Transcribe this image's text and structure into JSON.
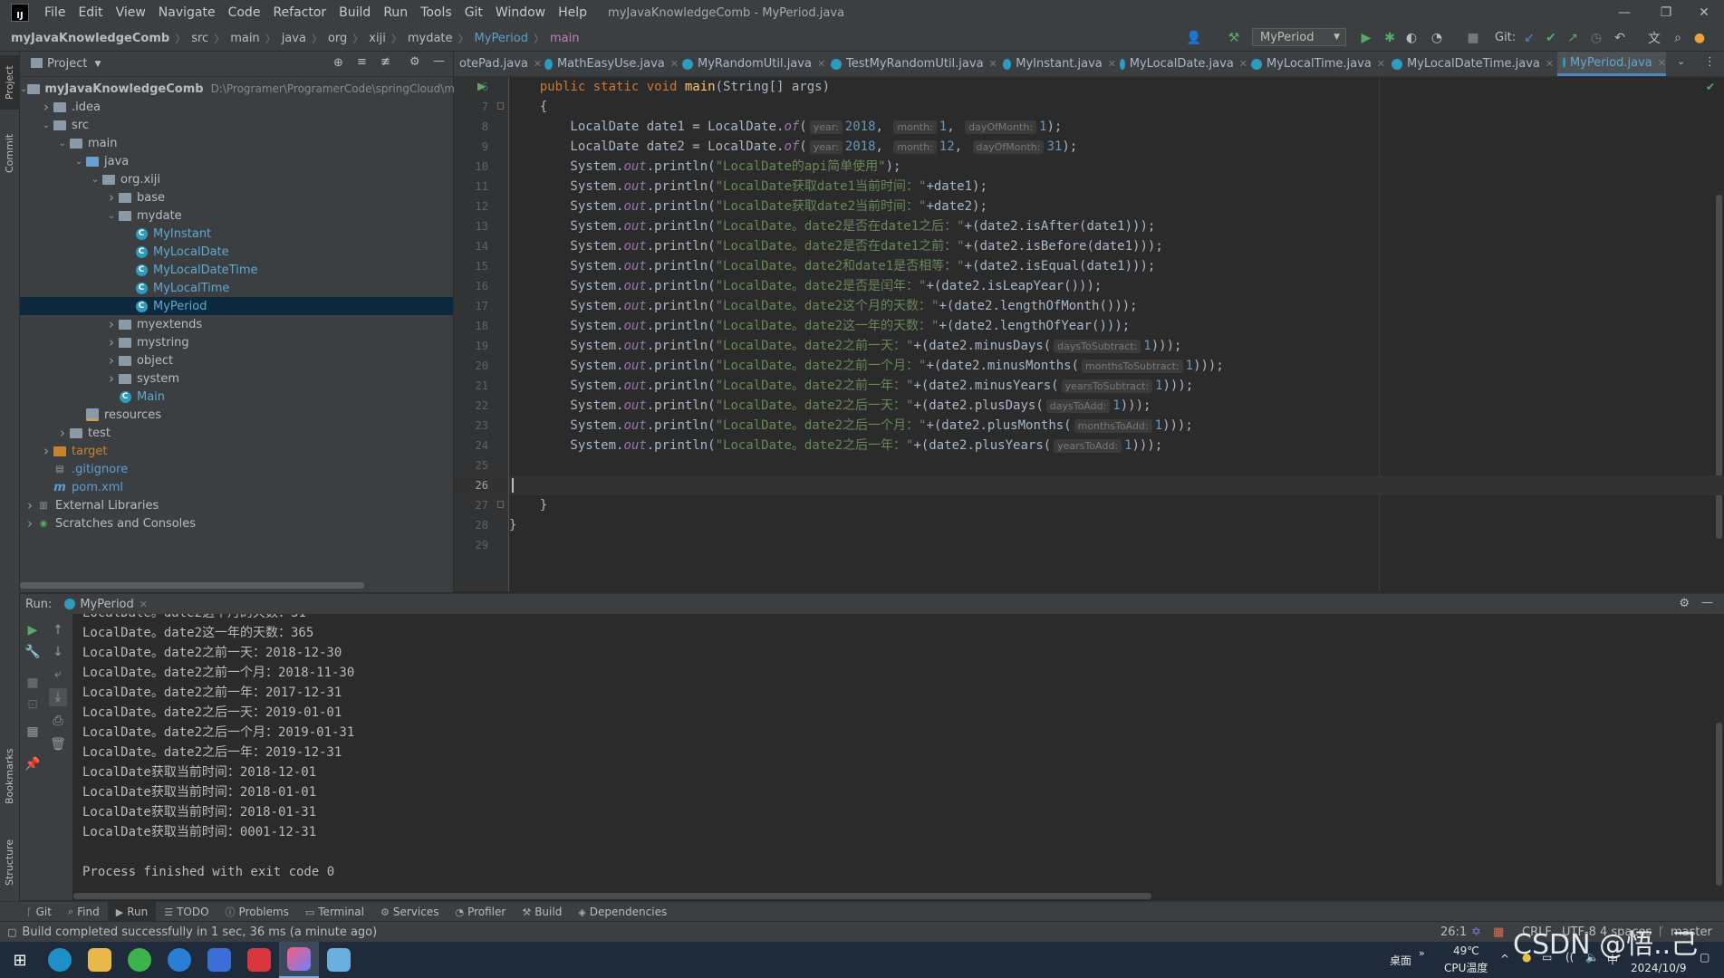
{
  "menubar": {
    "menus": [
      "File",
      "Edit",
      "View",
      "Navigate",
      "Code",
      "Refactor",
      "Build",
      "Run",
      "Tools",
      "Git",
      "Window",
      "Help"
    ],
    "window_title": "myJavaKnowledgeComb - MyPeriod.java",
    "logo": "IJ"
  },
  "navbar": {
    "crumbs": [
      "myJavaKnowledgeComb",
      "src",
      "main",
      "java",
      "org",
      "xiji",
      "mydate",
      "MyPeriod",
      "main"
    ],
    "run_config": "MyPeriod",
    "git_label": "Git:"
  },
  "left_strip": {
    "project": "Project",
    "commit": "Commit",
    "bookmarks": "Bookmarks",
    "structure": "Structure"
  },
  "project": {
    "title": "Project",
    "tree": [
      {
        "label": "myJavaKnowledgeComb",
        "extra": "D:\\Programer\\ProgramerCode\\springCloud\\my...",
        "indent": 0,
        "arrow": "down",
        "icon": "folder"
      },
      {
        "label": ".idea",
        "indent": 1,
        "arrow": "right",
        "icon": "folder"
      },
      {
        "label": "src",
        "indent": 1,
        "arrow": "down",
        "icon": "folder"
      },
      {
        "label": "main",
        "indent": 2,
        "arrow": "down",
        "icon": "folder"
      },
      {
        "label": "java",
        "indent": 3,
        "arrow": "down",
        "icon": "folder-blue"
      },
      {
        "label": "org.xiji",
        "indent": 4,
        "arrow": "down",
        "icon": "folder"
      },
      {
        "label": "base",
        "indent": 5,
        "arrow": "right",
        "icon": "folder"
      },
      {
        "label": "mydate",
        "indent": 5,
        "arrow": "down",
        "icon": "folder"
      },
      {
        "label": "MyInstant",
        "indent": 6,
        "arrow": "",
        "icon": "class"
      },
      {
        "label": "MyLocalDate",
        "indent": 6,
        "arrow": "",
        "icon": "class"
      },
      {
        "label": "MyLocalDateTime",
        "indent": 6,
        "arrow": "",
        "icon": "class"
      },
      {
        "label": "MyLocalTime",
        "indent": 6,
        "arrow": "",
        "icon": "class"
      },
      {
        "label": "MyPeriod",
        "indent": 6,
        "arrow": "",
        "icon": "class",
        "selected": true
      },
      {
        "label": "myextends",
        "indent": 5,
        "arrow": "right",
        "icon": "folder"
      },
      {
        "label": "mystring",
        "indent": 5,
        "arrow": "right",
        "icon": "folder"
      },
      {
        "label": "object",
        "indent": 5,
        "arrow": "right",
        "icon": "folder"
      },
      {
        "label": "system",
        "indent": 5,
        "arrow": "right",
        "icon": "folder"
      },
      {
        "label": "Main",
        "indent": 5,
        "arrow": "",
        "icon": "class"
      },
      {
        "label": "resources",
        "indent": 3,
        "arrow": "",
        "icon": "folder-res"
      },
      {
        "label": "test",
        "indent": 2,
        "arrow": "right",
        "icon": "folder"
      },
      {
        "label": "target",
        "indent": 1,
        "arrow": "right",
        "icon": "folder-orange",
        "excluded": true
      },
      {
        "label": ".gitignore",
        "indent": 1,
        "arrow": "",
        "icon": "file",
        "vcs": true
      },
      {
        "label": "pom.xml",
        "indent": 1,
        "arrow": "",
        "icon": "maven",
        "vcs": true
      },
      {
        "label": "External Libraries",
        "indent": 0,
        "arrow": "right",
        "icon": "libs"
      },
      {
        "label": "Scratches and Consoles",
        "indent": 0,
        "arrow": "right",
        "icon": "scratch"
      }
    ]
  },
  "editor": {
    "tabs": [
      {
        "label": "otePad.java",
        "active": false
      },
      {
        "label": "MathEasyUse.java",
        "active": false
      },
      {
        "label": "MyRandomUtil.java",
        "active": false
      },
      {
        "label": "TestMyRandomUtil.java",
        "active": false
      },
      {
        "label": "MyInstant.java",
        "active": false
      },
      {
        "label": "MyLocalDate.java",
        "active": false
      },
      {
        "label": "MyLocalTime.java",
        "active": false
      },
      {
        "label": "MyLocalDateTime.java",
        "active": false
      },
      {
        "label": "MyPeriod.java",
        "active": true
      }
    ],
    "lines": [
      {
        "n": "6",
        "tokens": [
          [
            "    ",
            ""
          ],
          [
            "public static void ",
            "kw"
          ],
          [
            "main",
            "fn"
          ],
          [
            "(String[] args)",
            ""
          ]
        ]
      },
      {
        "n": "7",
        "tokens": [
          [
            "    {",
            ""
          ]
        ]
      },
      {
        "n": "8",
        "tokens": [
          [
            "        LocalDate date1 = LocalDate.",
            ""
          ],
          [
            "of",
            "stat"
          ],
          [
            "(",
            ""
          ],
          [
            "year:",
            "hint"
          ],
          [
            "2018",
            "num"
          ],
          [
            ", ",
            ""
          ],
          [
            "month:",
            "hint"
          ],
          [
            "1",
            "num"
          ],
          [
            ", ",
            ""
          ],
          [
            "dayOfMonth:",
            "hint"
          ],
          [
            "1",
            "num"
          ],
          [
            ");",
            ""
          ]
        ]
      },
      {
        "n": "9",
        "tokens": [
          [
            "        LocalDate date2 = LocalDate.",
            ""
          ],
          [
            "of",
            "stat"
          ],
          [
            "(",
            ""
          ],
          [
            "year:",
            "hint"
          ],
          [
            "2018",
            "num"
          ],
          [
            ", ",
            ""
          ],
          [
            "month:",
            "hint"
          ],
          [
            "12",
            "num"
          ],
          [
            ", ",
            ""
          ],
          [
            "dayOfMonth:",
            "hint"
          ],
          [
            "31",
            "num"
          ],
          [
            ");",
            ""
          ]
        ]
      },
      {
        "n": "10",
        "tokens": [
          [
            "        System.",
            ""
          ],
          [
            "out",
            "stat"
          ],
          [
            ".println(",
            ""
          ],
          [
            "\"LocalDate的api简单使用\"",
            "str"
          ],
          [
            ");",
            ""
          ]
        ]
      },
      {
        "n": "11",
        "tokens": [
          [
            "        System.",
            ""
          ],
          [
            "out",
            "stat"
          ],
          [
            ".println(",
            ""
          ],
          [
            "\"LocalDate获取date1当前时间：\"",
            "str"
          ],
          [
            "+date1);",
            ""
          ]
        ]
      },
      {
        "n": "12",
        "tokens": [
          [
            "        System.",
            ""
          ],
          [
            "out",
            "stat"
          ],
          [
            ".println(",
            ""
          ],
          [
            "\"LocalDate获取date2当前时间：\"",
            "str"
          ],
          [
            "+date2);",
            ""
          ]
        ]
      },
      {
        "n": "13",
        "tokens": [
          [
            "        System.",
            ""
          ],
          [
            "out",
            "stat"
          ],
          [
            ".println(",
            ""
          ],
          [
            "\"LocalDate。date2是否在date1之后：\"",
            "str"
          ],
          [
            "+(date2.isAfter(date1)));",
            ""
          ]
        ]
      },
      {
        "n": "14",
        "tokens": [
          [
            "        System.",
            ""
          ],
          [
            "out",
            "stat"
          ],
          [
            ".println(",
            ""
          ],
          [
            "\"LocalDate。date2是否在date1之前：\"",
            "str"
          ],
          [
            "+(date2.isBefore(date1)));",
            ""
          ]
        ]
      },
      {
        "n": "15",
        "tokens": [
          [
            "        System.",
            ""
          ],
          [
            "out",
            "stat"
          ],
          [
            ".println(",
            ""
          ],
          [
            "\"LocalDate。date2和date1是否相等：\"",
            "str"
          ],
          [
            "+(date2.isEqual(date1)));",
            ""
          ]
        ]
      },
      {
        "n": "16",
        "tokens": [
          [
            "        System.",
            ""
          ],
          [
            "out",
            "stat"
          ],
          [
            ".println(",
            ""
          ],
          [
            "\"LocalDate。date2是否是闰年：\"",
            "str"
          ],
          [
            "+(date2.isLeapYear()));",
            ""
          ]
        ]
      },
      {
        "n": "17",
        "tokens": [
          [
            "        System.",
            ""
          ],
          [
            "out",
            "stat"
          ],
          [
            ".println(",
            ""
          ],
          [
            "\"LocalDate。date2这个月的天数：\"",
            "str"
          ],
          [
            "+(date2.lengthOfMonth()));",
            ""
          ]
        ]
      },
      {
        "n": "18",
        "tokens": [
          [
            "        System.",
            ""
          ],
          [
            "out",
            "stat"
          ],
          [
            ".println(",
            ""
          ],
          [
            "\"LocalDate。date2这一年的天数：\"",
            "str"
          ],
          [
            "+(date2.lengthOfYear()));",
            ""
          ]
        ]
      },
      {
        "n": "19",
        "tokens": [
          [
            "        System.",
            ""
          ],
          [
            "out",
            "stat"
          ],
          [
            ".println(",
            ""
          ],
          [
            "\"LocalDate。date2之前一天：\"",
            "str"
          ],
          [
            "+(date2.minusDays(",
            ""
          ],
          [
            "daysToSubtract:",
            "hint"
          ],
          [
            "1",
            "num"
          ],
          [
            ")));",
            ""
          ]
        ]
      },
      {
        "n": "20",
        "tokens": [
          [
            "        System.",
            ""
          ],
          [
            "out",
            "stat"
          ],
          [
            ".println(",
            ""
          ],
          [
            "\"LocalDate。date2之前一个月：\"",
            "str"
          ],
          [
            "+(date2.minusMonths(",
            ""
          ],
          [
            "monthsToSubtract:",
            "hint"
          ],
          [
            "1",
            "num"
          ],
          [
            ")));",
            ""
          ]
        ]
      },
      {
        "n": "21",
        "tokens": [
          [
            "        System.",
            ""
          ],
          [
            "out",
            "stat"
          ],
          [
            ".println(",
            ""
          ],
          [
            "\"LocalDate。date2之前一年：\"",
            "str"
          ],
          [
            "+(date2.minusYears(",
            ""
          ],
          [
            "yearsToSubtract:",
            "hint"
          ],
          [
            "1",
            "num"
          ],
          [
            ")));",
            ""
          ]
        ]
      },
      {
        "n": "22",
        "tokens": [
          [
            "        System.",
            ""
          ],
          [
            "out",
            "stat"
          ],
          [
            ".println(",
            ""
          ],
          [
            "\"LocalDate。date2之后一天：\"",
            "str"
          ],
          [
            "+(date2.plusDays(",
            ""
          ],
          [
            "daysToAdd:",
            "hint"
          ],
          [
            "1",
            "num"
          ],
          [
            ")));",
            ""
          ]
        ]
      },
      {
        "n": "23",
        "tokens": [
          [
            "        System.",
            ""
          ],
          [
            "out",
            "stat"
          ],
          [
            ".println(",
            ""
          ],
          [
            "\"LocalDate。date2之后一个月：\"",
            "str"
          ],
          [
            "+(date2.plusMonths(",
            ""
          ],
          [
            "monthsToAdd:",
            "hint"
          ],
          [
            "1",
            "num"
          ],
          [
            ")));",
            ""
          ]
        ]
      },
      {
        "n": "24",
        "tokens": [
          [
            "        System.",
            ""
          ],
          [
            "out",
            "stat"
          ],
          [
            ".println(",
            ""
          ],
          [
            "\"LocalDate。date2之后一年：\"",
            "str"
          ],
          [
            "+(date2.plusYears(",
            ""
          ],
          [
            "yearsToAdd:",
            "hint"
          ],
          [
            "1",
            "num"
          ],
          [
            ")));",
            ""
          ]
        ]
      },
      {
        "n": "25",
        "tokens": []
      },
      {
        "n": "26",
        "tokens": [],
        "current": true
      },
      {
        "n": "27",
        "tokens": [
          [
            "    }",
            ""
          ]
        ]
      },
      {
        "n": "28",
        "tokens": [
          [
            "}",
            ""
          ]
        ]
      },
      {
        "n": "29",
        "tokens": []
      }
    ]
  },
  "run": {
    "label": "Run:",
    "tab": "MyPeriod",
    "output": [
      "LocalDate。date2这一年的天数：365",
      "LocalDate。date2之前一天：2018-12-30",
      "LocalDate。date2之前一个月：2018-11-30",
      "LocalDate。date2之前一年：2017-12-31",
      "LocalDate。date2之后一天：2019-01-01",
      "LocalDate。date2之后一个月：2019-01-31",
      "LocalDate。date2之后一年：2019-12-31",
      "LocalDate获取当前时间：2018-12-01",
      "LocalDate获取当前时间：2018-01-01",
      "LocalDate获取当前时间：2018-01-31",
      "LocalDate获取当前时间：0001-12-31",
      "",
      "Process finished with exit code 0"
    ]
  },
  "bottom_tabs": [
    {
      "label": "Git",
      "icon": "git"
    },
    {
      "label": "Find",
      "icon": "find"
    },
    {
      "label": "Run",
      "icon": "run",
      "active": true
    },
    {
      "label": "TODO",
      "icon": "todo"
    },
    {
      "label": "Problems",
      "icon": "problems"
    },
    {
      "label": "Terminal",
      "icon": "terminal"
    },
    {
      "label": "Services",
      "icon": "services"
    },
    {
      "label": "Profiler",
      "icon": "profiler"
    },
    {
      "label": "Build",
      "icon": "build"
    },
    {
      "label": "Dependencies",
      "icon": "dependencies"
    }
  ],
  "status": {
    "message": "Build completed successfully in 1 sec, 36 ms (a minute ago)",
    "position": "26:1",
    "line_sep": "CRLF",
    "encoding": "UTF-8",
    "indent": "4 spaces",
    "branch": "master"
  },
  "taskbar": {
    "desktop": "桌面",
    "temp": "49℃",
    "temp_label": "CPU温度",
    "ime": "中",
    "date": "2024/10/9",
    "watermark": "CSDN @悟..己"
  },
  "colors": {
    "accent": "#4a88c7",
    "selection": "#0d293e",
    "editor_bg": "#2b2b2b",
    "panel_bg": "#3c3f41"
  }
}
